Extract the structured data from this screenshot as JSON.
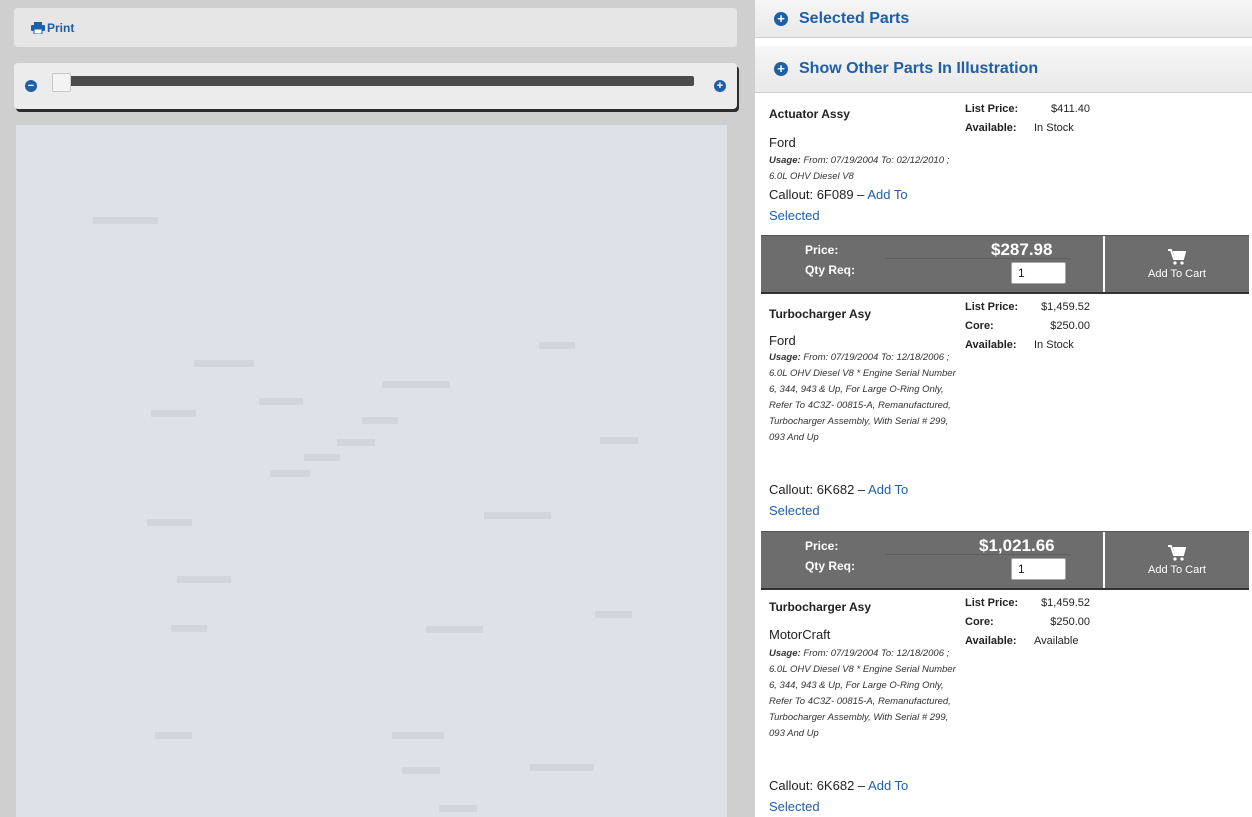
{
  "toolbar": {
    "print_label": "Print"
  },
  "zoom": {
    "minus": "−",
    "plus": "+"
  },
  "sections": {
    "selected_parts": "Selected Parts",
    "other_parts": "Show Other Parts In Illustration"
  },
  "labels": {
    "list_price": "List Price:",
    "core": "Core:",
    "available": "Available:",
    "price": "Price:",
    "qty_req": "Qty Req:",
    "add_to_cart": "Add To Cart",
    "usage": "Usage:",
    "callout_prefix": "Callout:",
    "add_to_selected": "Add To Selected"
  },
  "parts": [
    {
      "name": "Actuator Assy",
      "brand": "Ford",
      "usage": "From: 07/19/2004 To: 02/12/2010 ; 6.0L OHV Diesel V8",
      "callout": "6F089 –",
      "list_price": "$411.40",
      "core": "",
      "available": "In Stock",
      "price": "$287.98",
      "qty": "1"
    },
    {
      "name": "Turbocharger Asy",
      "brand": "Ford",
      "usage": "From: 07/19/2004 To: 12/18/2006 ; 6.0L OHV Diesel V8 * Engine Serial Number 6, 344, 943 & Up, For Large O-Ring Only, Refer To 4C3Z- 00815-A, Remanufactured, Turbocharger Assembly, With Serial # 299, 093 And Up",
      "callout": "6K682 –",
      "list_price": "$1,459.52",
      "core": "$250.00",
      "available": "In Stock",
      "price": "$1,021.66",
      "qty": "1"
    },
    {
      "name": "Turbocharger Asy",
      "brand": "MotorCraft",
      "usage": "From: 07/19/2004 To: 12/18/2006 ; 6.0L OHV Diesel V8 * Engine Serial Number 6, 344, 943 & Up, For Large O-Ring Only, Refer To 4C3Z- 00815-A, Remanufactured, Turbocharger Assembly, With Serial # 299, 093 And Up",
      "callout": "6K682 –",
      "list_price": "$1,459.52",
      "core": "$250.00",
      "available": "Available"
    }
  ],
  "colors": {
    "accent": "#1f5fa8",
    "cart_bar": "#6d6d6d",
    "illustration_bg": "#dde1e8"
  }
}
